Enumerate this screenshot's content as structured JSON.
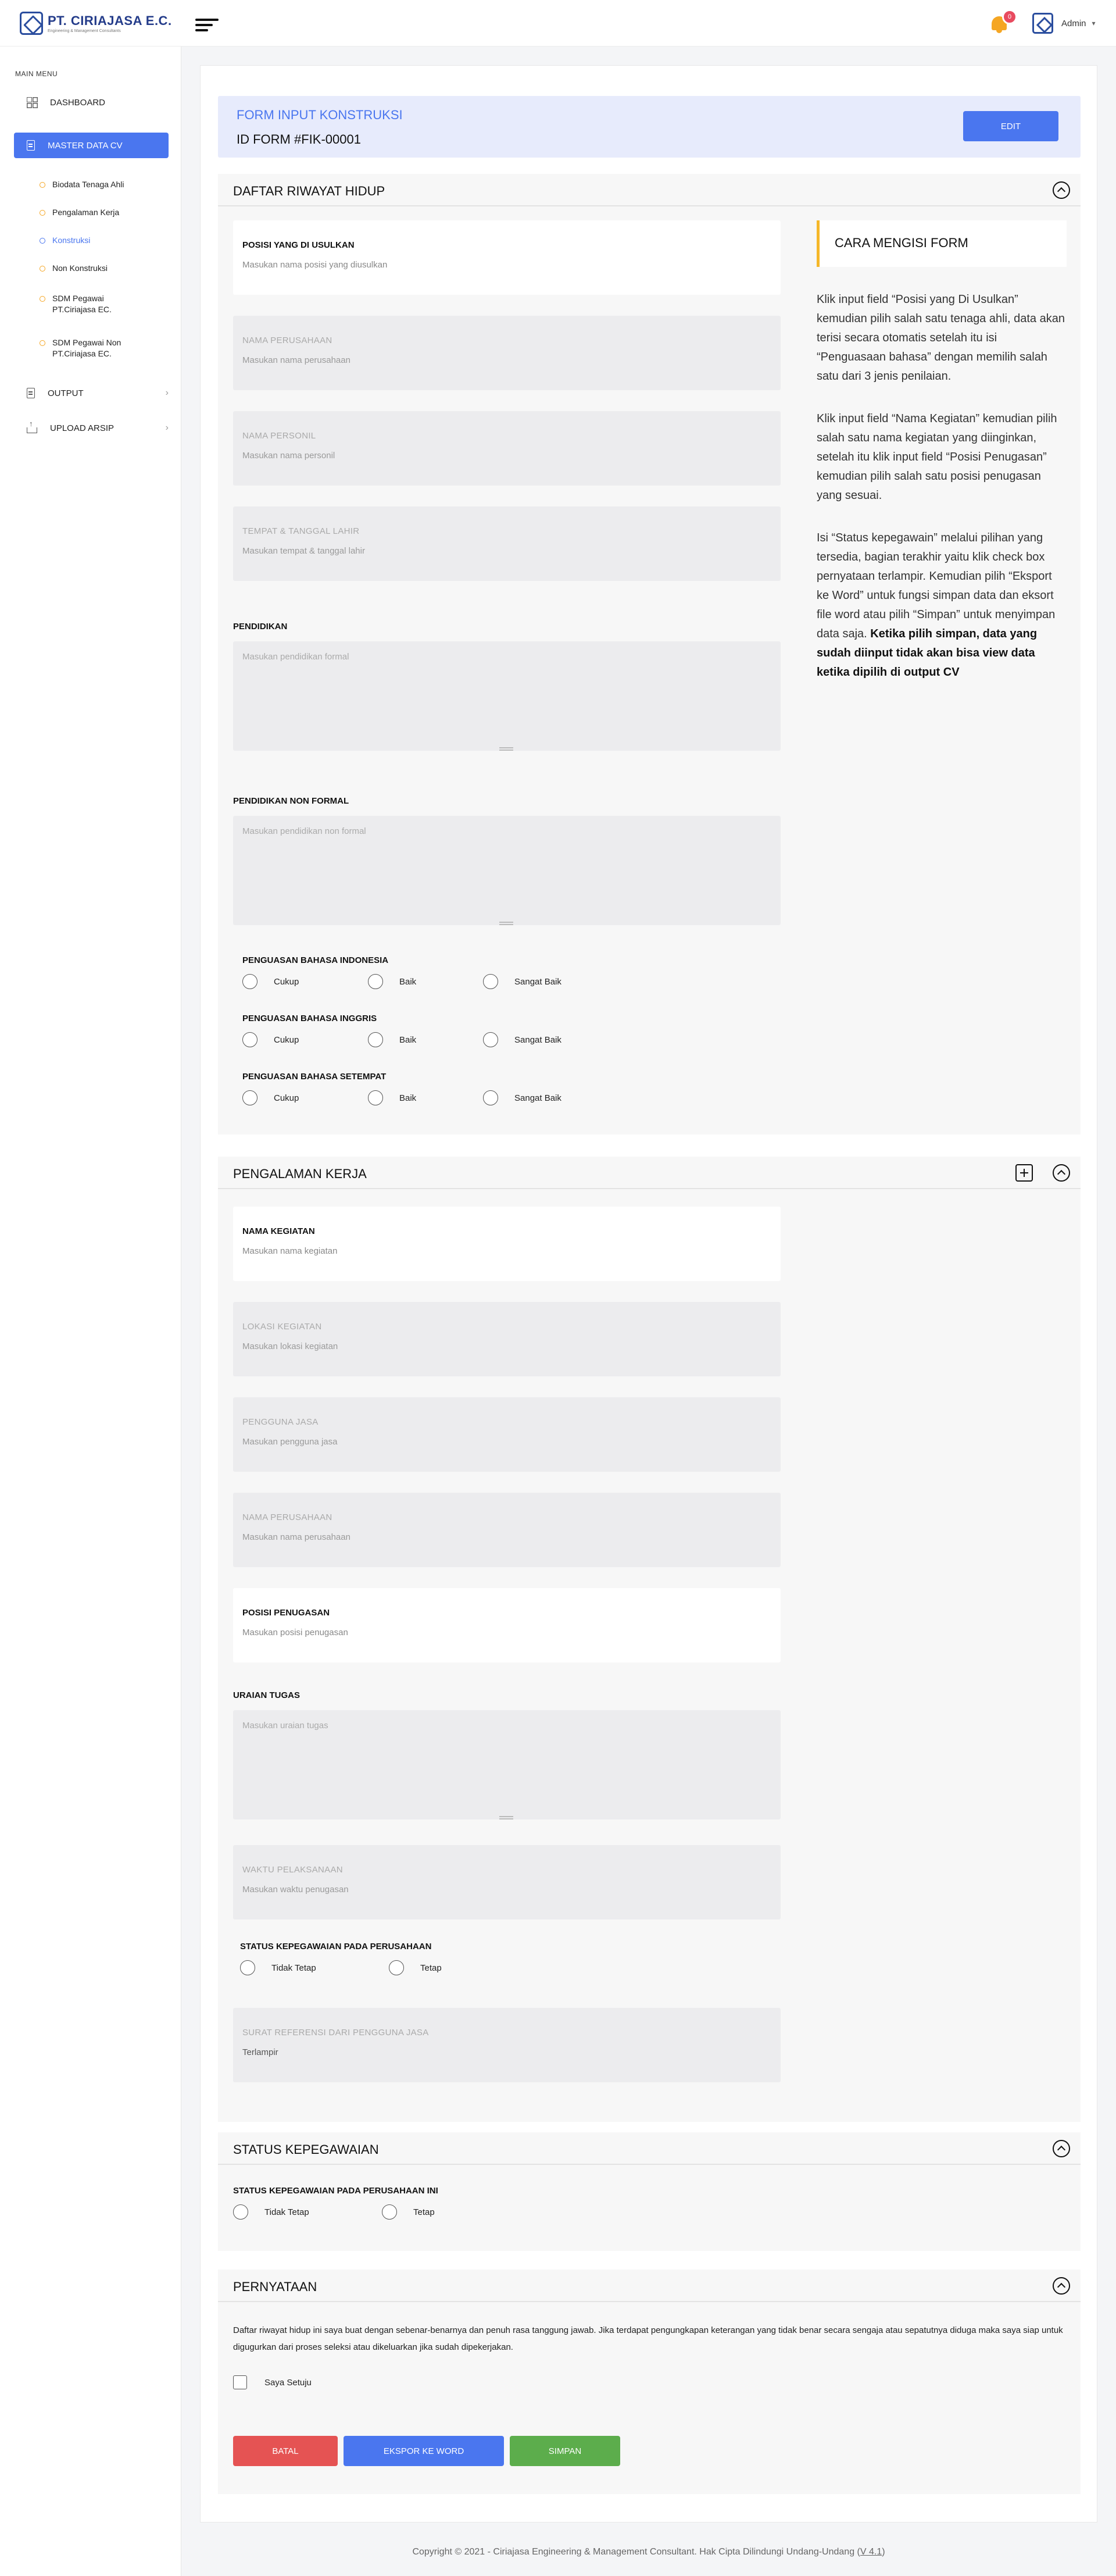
{
  "header": {
    "logo_name": "PT. CIRIAJASA E.C.",
    "logo_sub": "Engineering & Management Consultants",
    "notification_count": "0",
    "user_name": "Admin"
  },
  "sidebar": {
    "menu_heading": "MAIN MENU",
    "items": [
      {
        "label": "DASHBOARD",
        "icon": "grid-icon"
      },
      {
        "label": "MASTER DATA CV",
        "icon": "file-icon"
      },
      {
        "label": "OUTPUT",
        "icon": "document-icon"
      },
      {
        "label": "UPLOAD ARSIP",
        "icon": "upload-icon"
      }
    ],
    "subitems": [
      "Biodata Tenaga Ahli",
      "Pengalaman Kerja",
      "Konstruksi",
      "Non Konstruksi",
      "SDM Pegawai PT.Ciriajasa EC.",
      "SDM Pegawai Non PT.Ciriajasa EC."
    ],
    "active_color": "#4a76ef"
  },
  "form": {
    "title": "FORM INPUT KONSTRUKSI",
    "id": "ID FORM #FIK-00001",
    "edit_label": "EDIT"
  },
  "cv_section": {
    "title": "DAFTAR RIWAYAT HIDUP",
    "fields": [
      {
        "label": "POSISI YANG DI USULKAN",
        "placeholder": "Masukan nama posisi yang diusulkan"
      },
      {
        "label": "NAMA PERUSAHAAN",
        "placeholder": "Masukan nama perusahaan"
      },
      {
        "label": "NAMA PERSONIL",
        "placeholder": "Masukan nama personil"
      },
      {
        "label": "TEMPAT & TANGGAL LAHIR",
        "placeholder": "Masukan tempat & tanggal lahir"
      }
    ],
    "pendidikan_label": "PENDIDIKAN",
    "pendidikan_placeholder": "Masukan pendidikan formal",
    "non_formal_label": "PENDIDIKAN NON FORMAL",
    "non_formal_placeholder": "Masukan pendidikan non formal",
    "languages": [
      {
        "label": "PENGUASAN BAHASA INDONESIA"
      },
      {
        "label": "PENGUASAN BAHASA INGGRIS"
      },
      {
        "label": "PENGUASAN BAHASA SETEMPAT"
      }
    ],
    "language_options": [
      "Cukup",
      "Baik",
      "Sangat Baik"
    ]
  },
  "help": {
    "title": "CARA MENGISI FORM",
    "para1": "Klik input field “Posisi yang Di Usulkan” kemudian pilih salah satu tenaga ahli, data akan terisi secara otomatis setelah itu isi “Penguasaan bahasa” dengan memilih salah satu dari 3 jenis penilaian.",
    "para2": "Klik input field “Nama Kegiatan” kemudian pilih salah satu nama kegiatan yang diinginkan, setelah itu klik input field “Posisi Penugasan” kemudian pilih salah satu posisi penugasan yang sesuai.",
    "para3": "Isi “Status kepegawain” melalui pilihan yang tersedia, bagian terakhir yaitu klik check box pernyataan terlampir. Kemudian pilih “Eksport ke Word” untuk fungsi simpan data dan eksort file word atau pilih “Simpan” untuk menyimpan data saja.",
    "para3_bold": "Ketika pilih simpan, data yang sudah diinput tidak akan bisa view data ketika dipilih di output CV"
  },
  "work_section": {
    "title": "PENGALAMAN KERJA",
    "fields": [
      {
        "label": "NAMA KEGIATAN",
        "placeholder": "Masukan nama kegiatan"
      },
      {
        "label": "LOKASI KEGIATAN",
        "placeholder": "Masukan lokasi kegiatan"
      },
      {
        "label": "PENGGUNA JASA",
        "placeholder": "Masukan pengguna jasa"
      },
      {
        "label": "NAMA PERUSAHAAN",
        "placeholder": "Masukan nama perusahaan"
      },
      {
        "label": "POSISI PENUGASAN",
        "placeholder": "Masukan posisi penugasan"
      }
    ],
    "uraian_label": "URAIAN TUGAS",
    "uraian_placeholder": "Masukan uraian tugas",
    "waktu_label": "WAKTU PELAKSANAAN",
    "waktu_placeholder": "Masukan waktu penugasan",
    "status_label": "STATUS KEPEGAWAIAN PADA PERUSAHAAN",
    "status_options": [
      "Tidak Tetap",
      "Tetap"
    ],
    "surat_label": "SURAT REFERENSI DARI PENGGUNA JASA",
    "surat_value": "Terlampir"
  },
  "status_section": {
    "title": "STATUS KEPEGAWAIAN",
    "label": "STATUS KEPEGAWAIAN PADA PERUSAHAAN INI",
    "options": [
      "Tidak Tetap",
      "Tetap"
    ]
  },
  "statement_section": {
    "title": "PERNYATAAN",
    "text": "Daftar riwayat hidup ini saya buat dengan sebenar-benarnya dan penuh rasa tanggung jawab. Jika terdapat pengungkapan keterangan yang tidak benar secara sengaja atau sepatutnya diduga maka saya siap untuk digugurkan dari proses seleksi atau dikeluarkan jika sudah dipekerjakan.",
    "agree_label": "Saya Setuju"
  },
  "actions": {
    "cancel": "BATAL",
    "export": "EKSPOR KE WORD",
    "save": "SIMPAN",
    "cancel_color": "#e55353",
    "export_color": "#4a76ef",
    "save_color": "#5cad4c"
  },
  "footer": {
    "text": "Copyright © 2021 - Ciriajasa Engineering & Management Consultant. Hak Cipta Dilindungi Undang-Undang (",
    "version": "V 4.1",
    "close": ")"
  }
}
